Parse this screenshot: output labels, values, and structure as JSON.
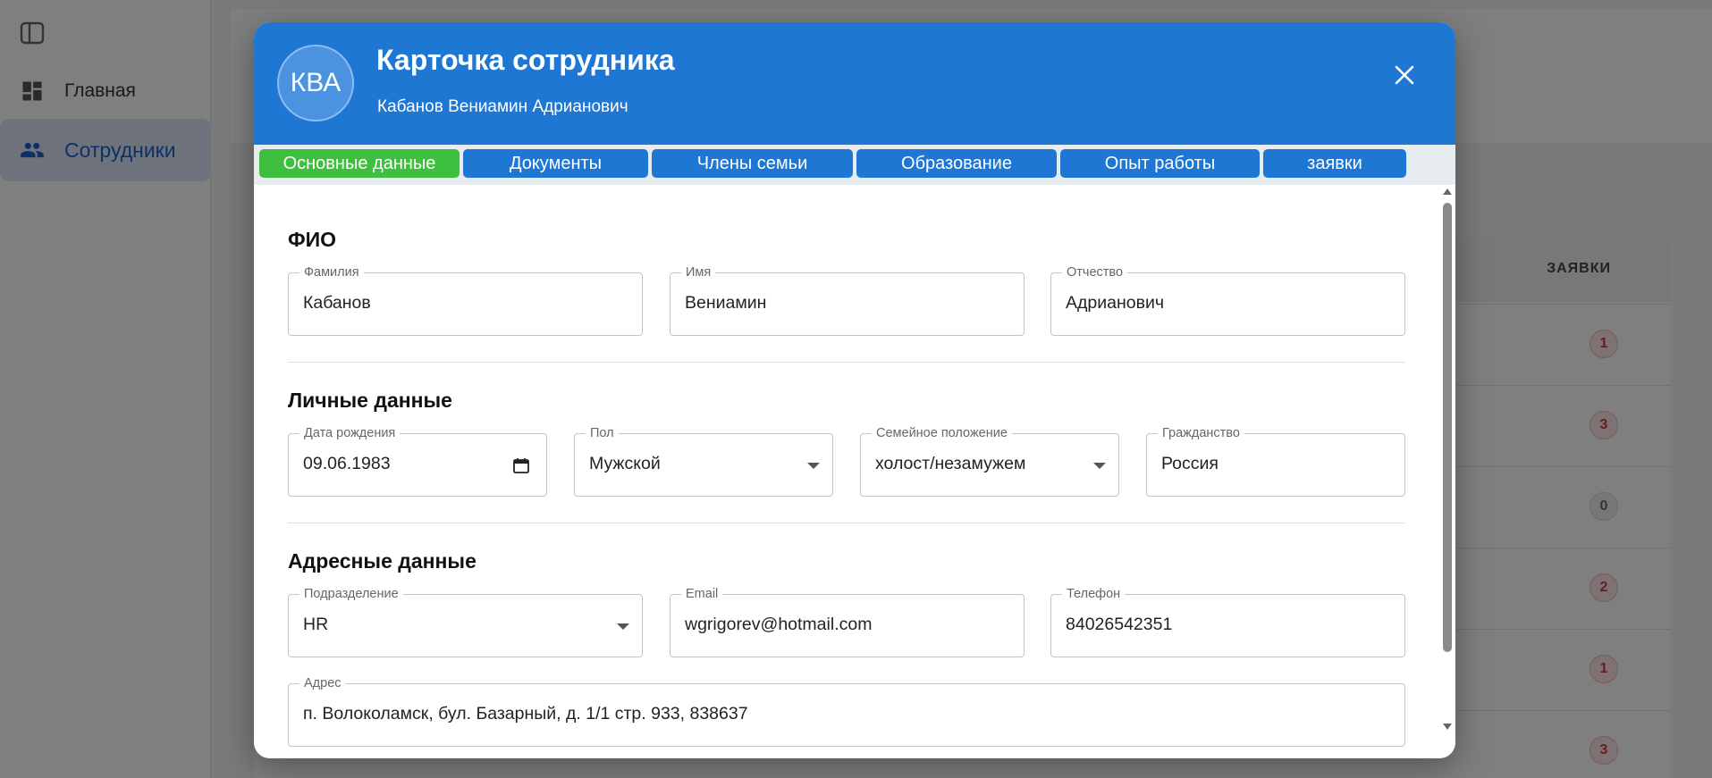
{
  "sidebar": {
    "items": [
      {
        "label": "Главная",
        "icon": "dashboard-icon"
      },
      {
        "label": "Сотрудники",
        "icon": "people-icon"
      }
    ]
  },
  "table": {
    "column_header": "ЗАЯВКИ",
    "badges": [
      "1",
      "3",
      "0",
      "2",
      "1",
      "3"
    ]
  },
  "modal": {
    "avatar_initials": "КВА",
    "title": "Карточка сотрудника",
    "subtitle": "Кабанов Вениамин Адрианович",
    "tabs": [
      {
        "label": "Основные данные",
        "active": true
      },
      {
        "label": "Документы",
        "active": false
      },
      {
        "label": "Члены семьи",
        "active": false
      },
      {
        "label": "Образование",
        "active": false
      },
      {
        "label": "Опыт работы",
        "active": false
      },
      {
        "label": "заявки",
        "active": false
      }
    ],
    "sections": {
      "fio": {
        "title": "ФИО",
        "last_name": {
          "label": "Фамилия",
          "value": "Кабанов"
        },
        "first_name": {
          "label": "Имя",
          "value": "Вениамин"
        },
        "patronymic": {
          "label": "Отчество",
          "value": "Адрианович"
        }
      },
      "personal": {
        "title": "Личные данные",
        "birth_date": {
          "label": "Дата рождения",
          "value": "09.06.1983"
        },
        "gender": {
          "label": "Пол",
          "value": "Мужской"
        },
        "marital_status": {
          "label": "Семейное положение",
          "value": "холост/незамужем"
        },
        "citizenship": {
          "label": "Гражданство",
          "value": "Россия"
        }
      },
      "address": {
        "title": "Адресные данные",
        "department": {
          "label": "Подразделение",
          "value": "HR"
        },
        "email": {
          "label": "Email",
          "value": "wgrigorev@hotmail.com"
        },
        "phone": {
          "label": "Телефон",
          "value": "84026542351"
        },
        "address": {
          "label": "Адрес",
          "value": "п. Волоколамск, бул. Базарный, д. 1/1 стр. 933, 838637"
        }
      }
    }
  },
  "colors": {
    "header_blue": "#1f77d4",
    "active_tab_green": "#3fbf3f",
    "badge_red": "#d13a3a"
  }
}
